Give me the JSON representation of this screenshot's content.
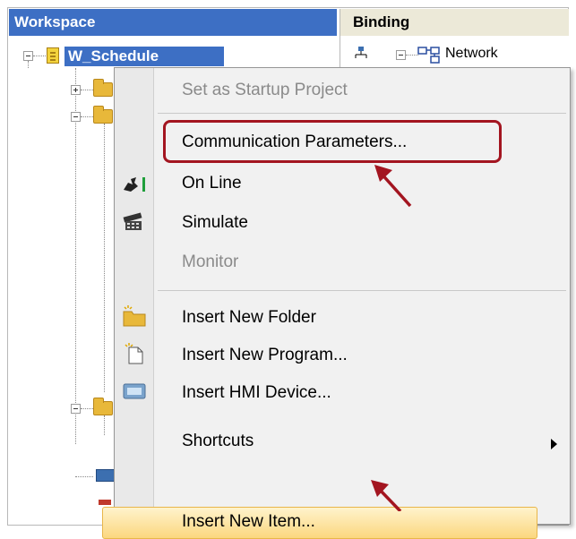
{
  "workspace": {
    "header": "Workspace",
    "project_label": "W_Schedule"
  },
  "binding": {
    "header": "Binding",
    "network_label": "Network"
  },
  "context_menu": {
    "items": [
      {
        "label": "Set as Startup Project",
        "state": "disabled"
      },
      {
        "label": "Communication Parameters...",
        "state": "enabled",
        "annotated": true
      },
      {
        "label": "On Line",
        "state": "enabled",
        "icon": "online-icon"
      },
      {
        "label": "Simulate",
        "state": "enabled",
        "icon": "simulate-icon"
      },
      {
        "label": "Monitor",
        "state": "disabled"
      },
      {
        "label": "Insert New Folder",
        "state": "enabled",
        "icon": "folder-icon"
      },
      {
        "label": "Insert New Program...",
        "state": "enabled",
        "icon": "new-program-icon"
      },
      {
        "label": "Insert HMI Device...",
        "state": "enabled",
        "icon": "hmi-device-icon"
      },
      {
        "label": "Shortcuts",
        "state": "enabled",
        "has_submenu": true
      },
      {
        "label": "Insert New Item...",
        "state": "hovered",
        "annotated": true
      }
    ]
  },
  "colors": {
    "selection_blue": "#3d6fc4",
    "annotation_red": "#a31520",
    "hover_gold": "#fbd77f"
  }
}
